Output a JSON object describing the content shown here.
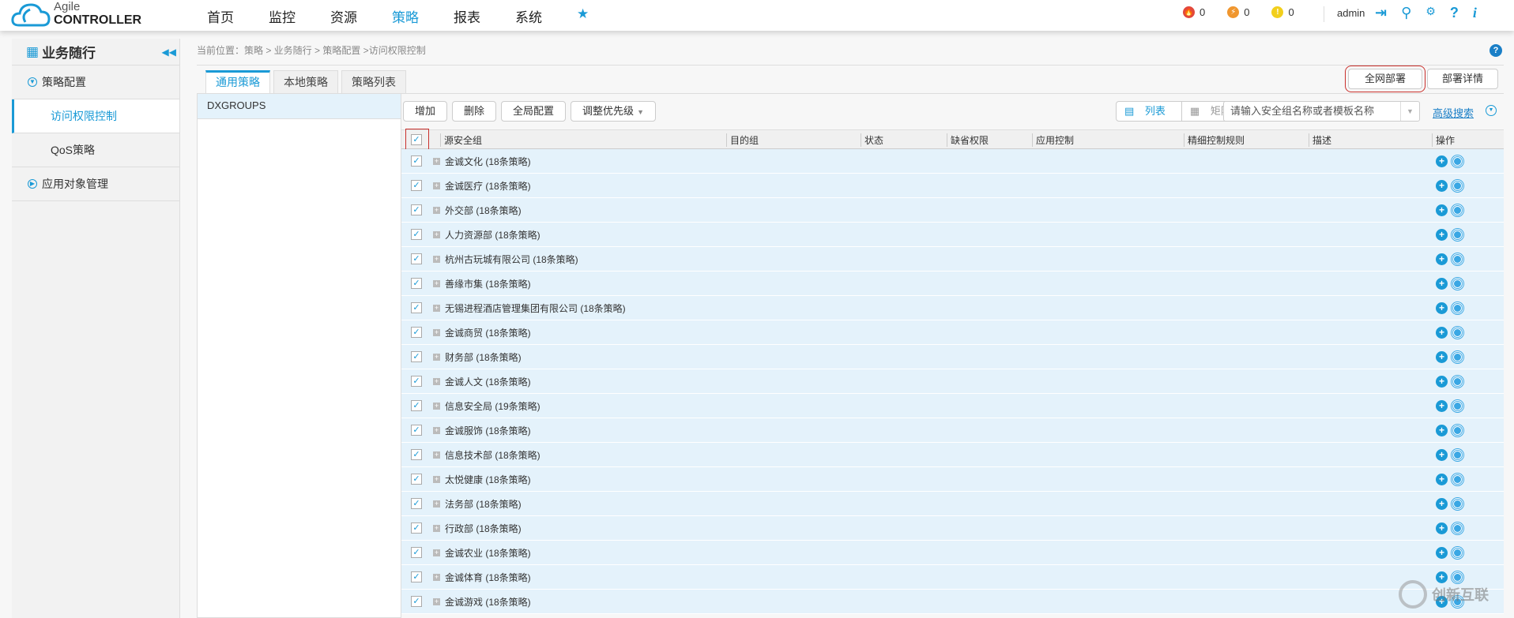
{
  "header": {
    "logo_line1": "Agile",
    "logo_line2": "CONTROLLER",
    "nav": [
      "首页",
      "监控",
      "资源",
      "策略",
      "报表",
      "系统"
    ],
    "nav_active": "策略",
    "star": "★",
    "alerts": [
      {
        "count": "0",
        "color": "#e2483b",
        "glyph": "🔥"
      },
      {
        "count": "0",
        "color": "#f0962e",
        "glyph": "⚡"
      },
      {
        "count": "0",
        "color": "#f2cf1c",
        "glyph": "!"
      }
    ],
    "user": "admin",
    "icons": [
      "logout-icon",
      "key-icon",
      "settings-icon",
      "help-icon",
      "info-icon"
    ],
    "help_glyph": "?",
    "info_glyph": "i"
  },
  "sidebar": {
    "title": "业务随行",
    "items": [
      {
        "label": "策略配置",
        "type": "group"
      },
      {
        "label": "访问权限控制",
        "type": "sub",
        "active": true
      },
      {
        "label": "QoS策略",
        "type": "sub"
      },
      {
        "label": "应用对象管理",
        "type": "group"
      }
    ]
  },
  "breadcrumb": "当前位置：策略 > 业务随行 > 策略配置 >访问权限控制",
  "tabs": [
    "通用策略",
    "本地策略",
    "策略列表"
  ],
  "top_buttons": {
    "deploy_all": "全网部署",
    "deploy_detail": "部署详情"
  },
  "groups": [
    "DXGROUPS"
  ],
  "toolbar": {
    "add": "增加",
    "delete": "删除",
    "global_config": "全局配置",
    "priority": "调整优先级"
  },
  "view": {
    "list": "列表",
    "matrix": "矩阵"
  },
  "search": {
    "placeholder": "请输入安全组名称或者模板名称"
  },
  "advanced_search": "高级搜索",
  "table": {
    "columns": [
      "源安全组",
      "目的组",
      "状态",
      "缺省权限",
      "应用控制",
      "精细控制规则",
      "描述",
      "操作"
    ],
    "rows": [
      "金诚文化 (18条策略)",
      "金诚医疗 (18条策略)",
      "外交部 (18条策略)",
      "人力资源部 (18条策略)",
      "杭州古玩城有限公司 (18条策略)",
      "善缘市集 (18条策略)",
      "无锡进程酒店管理集团有限公司 (18条策略)",
      "金诚商贸 (18条策略)",
      "财务部 (18条策略)",
      "金诚人文 (18条策略)",
      "信息安全局 (19条策略)",
      "金诚服饰 (18条策略)",
      "信息技术部 (18条策略)",
      "太悦健康 (18条策略)",
      "法务部 (18条策略)",
      "行政部 (18条策略)",
      "金诚农业 (18条策略)",
      "金诚体育 (18条策略)",
      "金诚游戏 (18条策略)"
    ]
  },
  "watermark": "创新互联"
}
